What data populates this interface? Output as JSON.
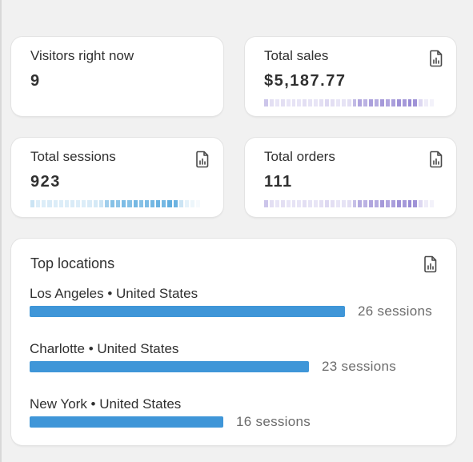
{
  "visitors": {
    "label": "Visitors right now",
    "value": "9"
  },
  "total_sales": {
    "label": "Total sales",
    "value": "$5,187.77",
    "icon": "report-icon"
  },
  "total_sessions": {
    "label": "Total sessions",
    "value": "923",
    "icon": "report-icon"
  },
  "total_orders": {
    "label": "Total orders",
    "value": "111",
    "icon": "report-icon"
  },
  "top_locations": {
    "title": "Top locations",
    "icon": "report-icon",
    "items": [
      {
        "label": "Los Angeles • United States",
        "count": "26 sessions",
        "sessions": 26
      },
      {
        "label": "Charlotte • United States",
        "count": "23 sessions",
        "sessions": 23
      },
      {
        "label": "New York • United States",
        "count": "16 sessions",
        "sessions": 16
      }
    ]
  },
  "colors": {
    "bar": "#3f96d8",
    "sales_spark": "#8e7fd0",
    "sessions_spark": "#52a6dc",
    "orders_spark": "#8e7fd0"
  }
}
